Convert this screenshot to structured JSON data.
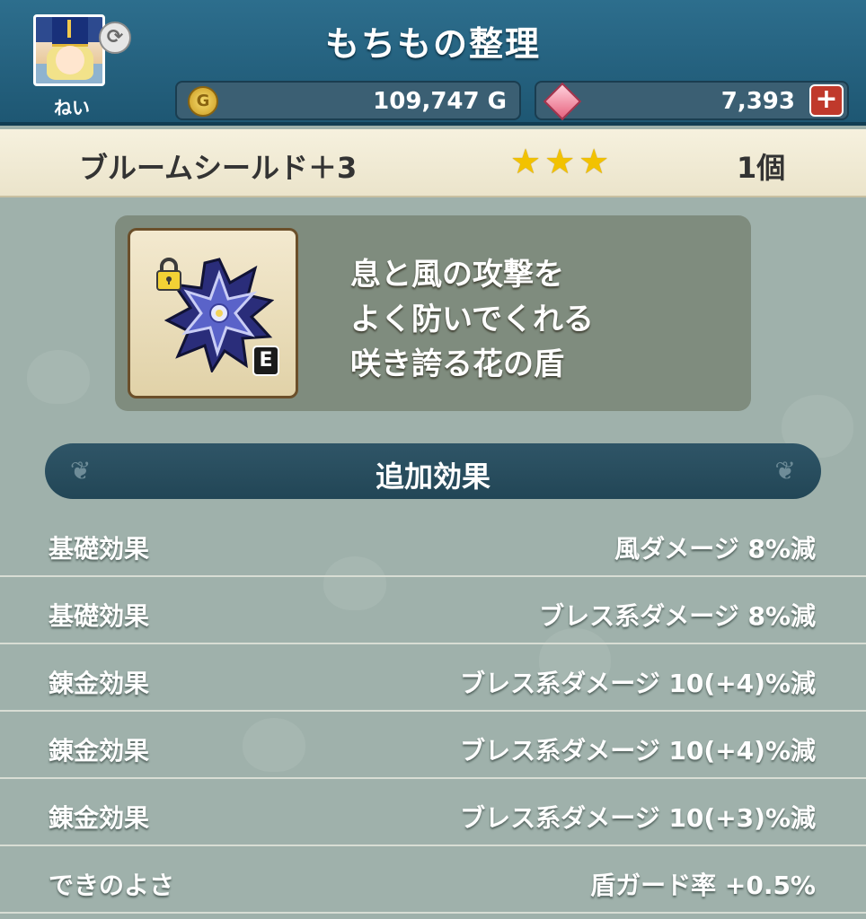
{
  "header": {
    "title": "もちもの整理",
    "player_name": "ねい",
    "gold": "109,747 G",
    "gems": "7,393",
    "add_label": "+"
  },
  "item": {
    "name": "ブルームシールド＋3",
    "stars": "★★★",
    "rarity_stars": 3,
    "count": "1個",
    "equipped_badge": "E",
    "description": [
      "息と風の攻撃を",
      "よく防いでくれる",
      "咲き誇る花の盾"
    ],
    "locked": true
  },
  "effects": {
    "title": "追加効果",
    "rows": [
      {
        "label": "基礎効果",
        "value": "風ダメージ 8%減"
      },
      {
        "label": "基礎効果",
        "value": "ブレス系ダメージ 8%減"
      },
      {
        "label": "錬金効果",
        "value": "ブレス系ダメージ 10(+4)%減"
      },
      {
        "label": "錬金効果",
        "value": "ブレス系ダメージ 10(+4)%減"
      },
      {
        "label": "錬金効果",
        "value": "ブレス系ダメージ 10(+3)%減"
      },
      {
        "label": "できのよさ",
        "value": "盾ガード率 +0.5%"
      }
    ]
  },
  "colors": {
    "header_bg": "#2d6e8d",
    "item_bar_bg": "#f6f1de",
    "panel_bg": "#9fb1ab",
    "star": "#f2c200",
    "add_button": "#c0392b"
  },
  "icons": [
    "swap-icon",
    "gold-coin-icon",
    "gem-icon",
    "plus-icon",
    "lock-icon",
    "shield-icon"
  ]
}
